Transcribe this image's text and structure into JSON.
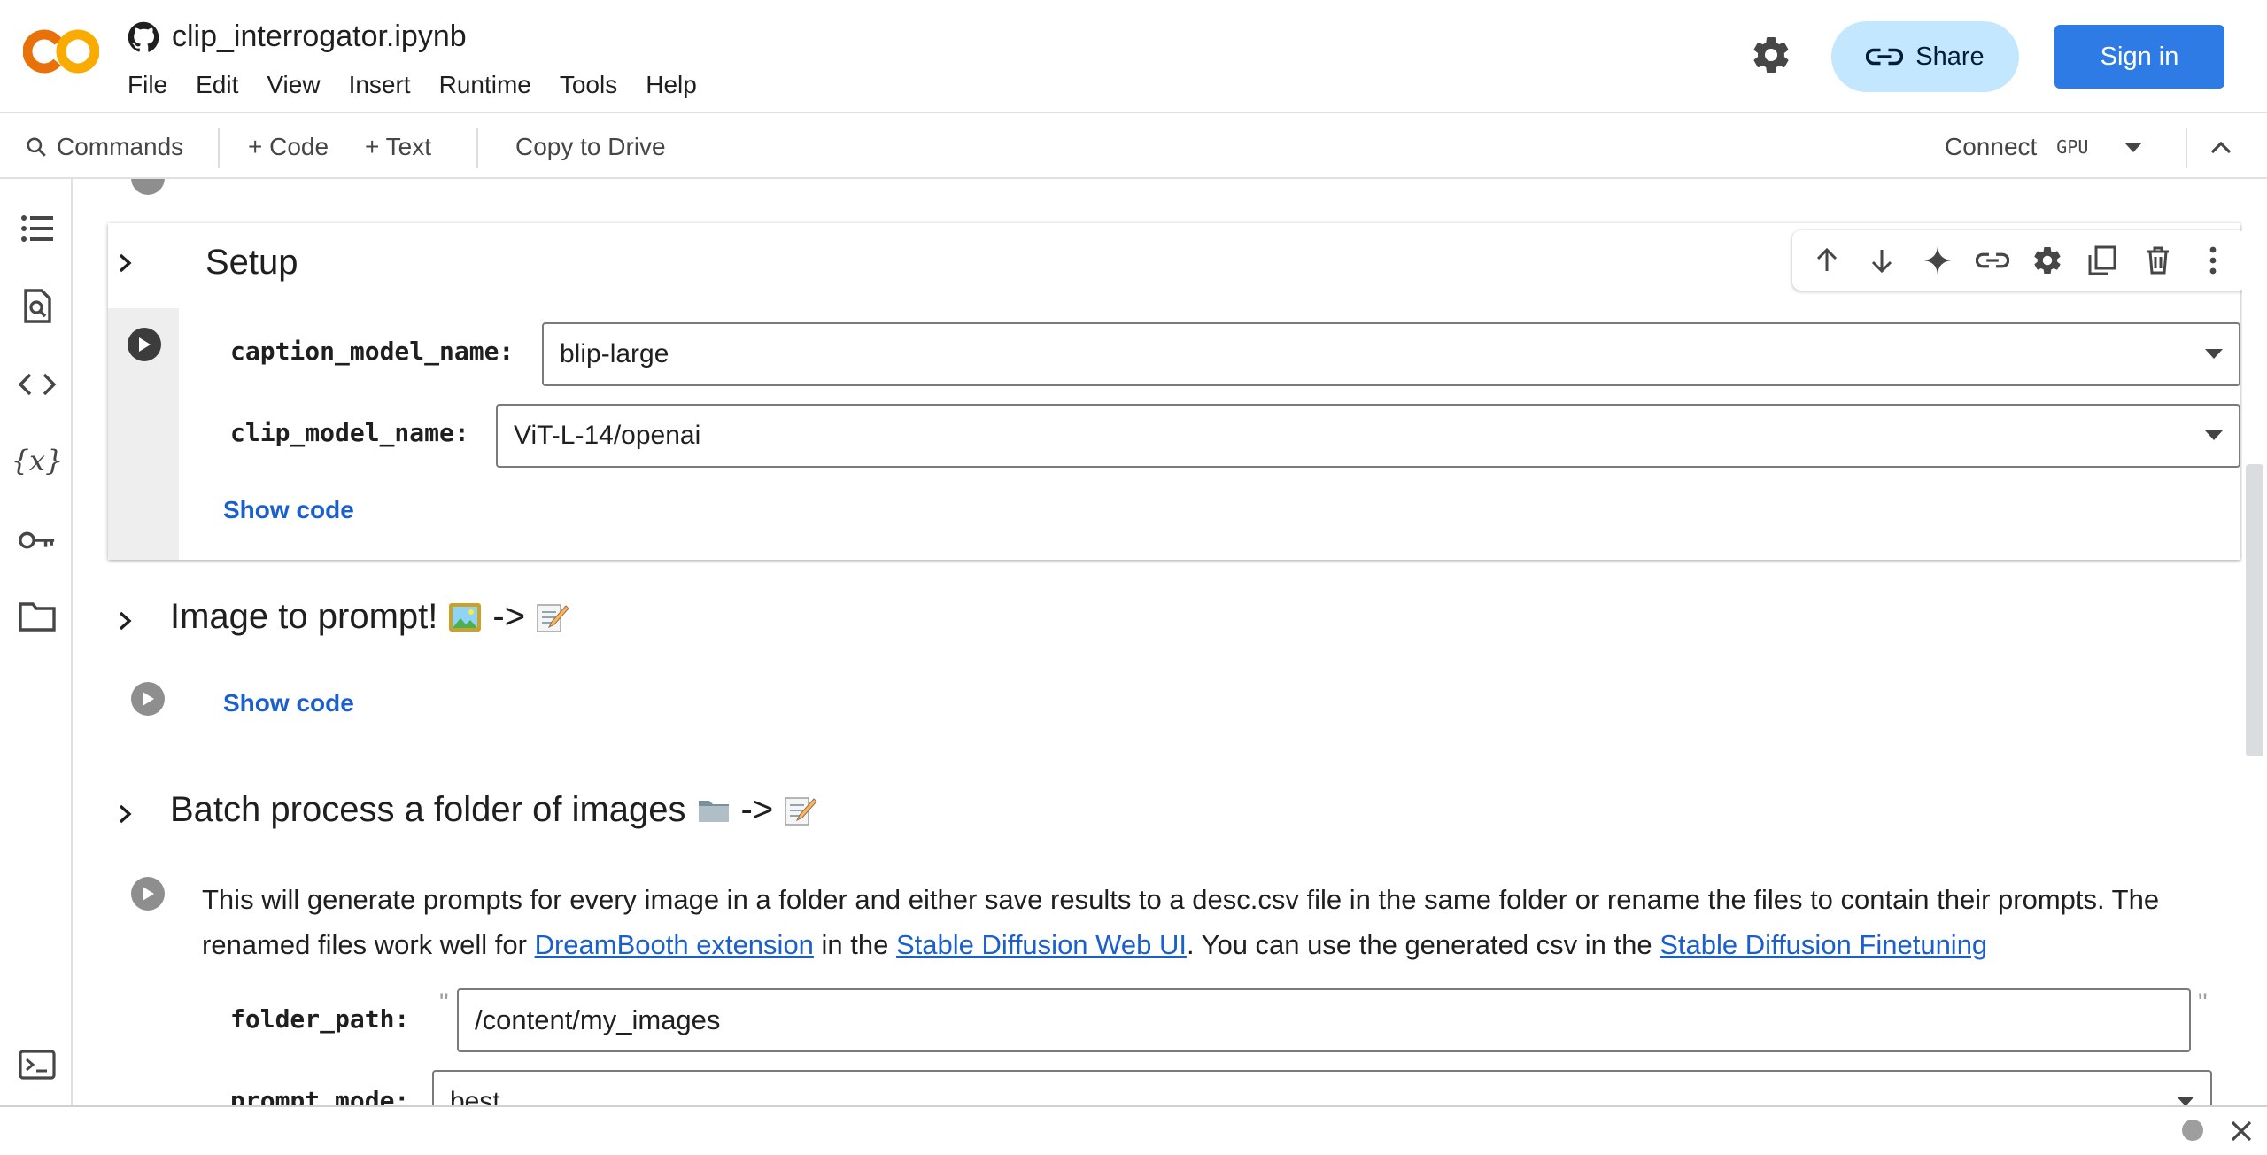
{
  "header": {
    "notebook_title": "clip_interrogator.ipynb",
    "menu": [
      "File",
      "Edit",
      "View",
      "Insert",
      "Runtime",
      "Tools",
      "Help"
    ],
    "share_label": "Share",
    "signin_label": "Sign in"
  },
  "toolbar": {
    "commands_label": "Commands",
    "add_code_label": "+ Code",
    "add_text_label": "+ Text",
    "copy_drive_label": "Copy to Drive",
    "connect_label": "Connect",
    "gpu_label": "GPU"
  },
  "rail": {
    "icons": [
      "toc-icon",
      "find-icon",
      "code-snippets-icon",
      "variables-icon",
      "secrets-key-icon",
      "files-folder-icon",
      "terminal-icon"
    ]
  },
  "cells": {
    "setup": {
      "heading": "Setup",
      "caption_label": "caption_model_name:",
      "caption_value": "blip-large",
      "clip_label": "clip_model_name:",
      "clip_value": "ViT-L-14/openai",
      "show_code": "Show code"
    },
    "image_to_prompt": {
      "heading": "Image to prompt!",
      "arrow": "->",
      "show_code": "Show code"
    },
    "batch": {
      "heading": "Batch process a folder of images",
      "arrow": "->",
      "desc_1": "This will generate prompts for every image in a folder and either save results to a desc.csv file in the same folder or rename the files to contain their prompts. The renamed files work well for ",
      "link_1": "DreamBooth extension",
      "desc_2": " in the ",
      "link_2": "Stable Diffusion Web UI",
      "desc_3": ". You can use the generated csv in the ",
      "link_3": "Stable Diffusion Finetuning",
      "folder_label": "folder_path:",
      "folder_value": "/content/my_images",
      "quote": "\"",
      "mode_label": "prompt_mode:",
      "mode_value": "best"
    }
  },
  "colors": {
    "accent": "#2f7be6",
    "share_bg": "#c2e7ff",
    "link": "#1a5fd0",
    "logo_orange": "#f9ab00",
    "logo_dark_orange": "#e8710a"
  }
}
